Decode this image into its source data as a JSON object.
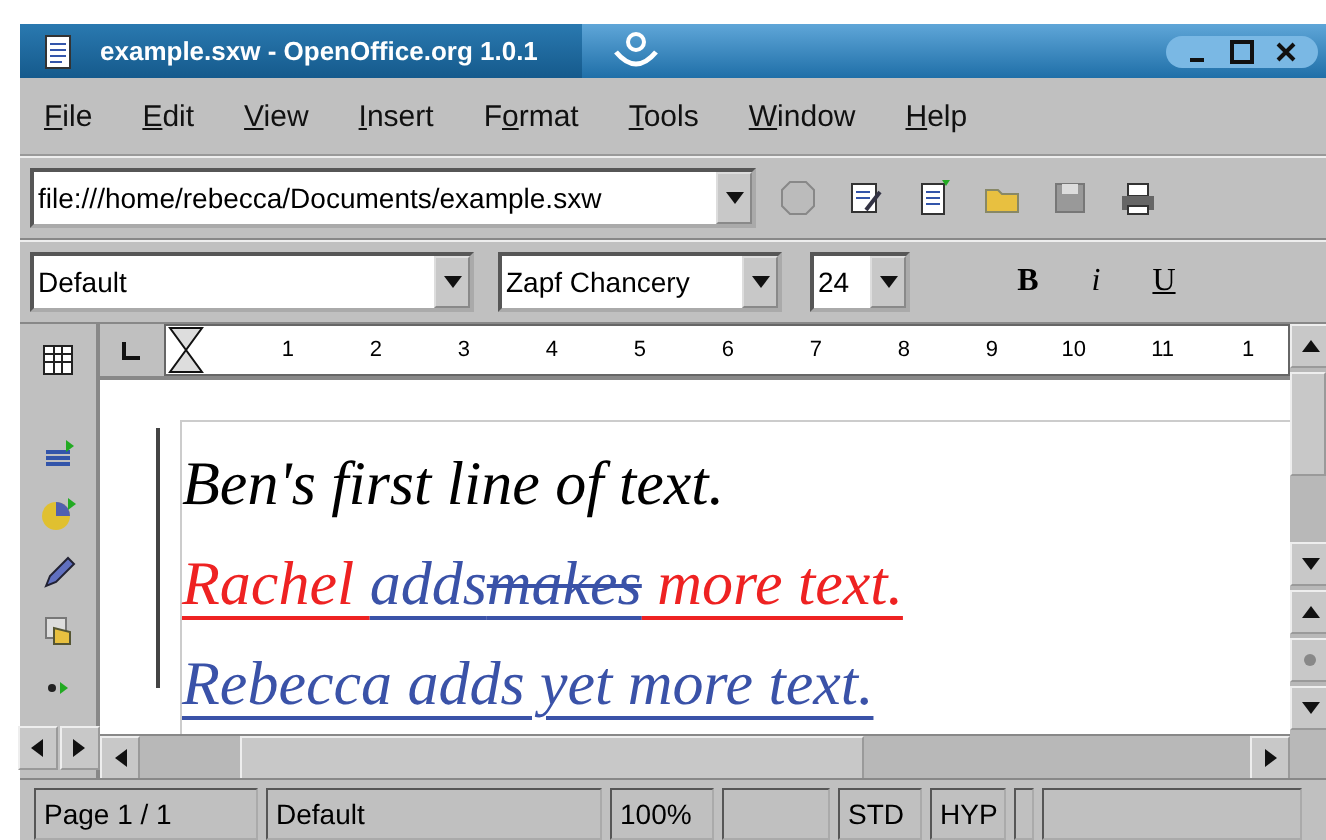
{
  "window": {
    "title": "example.sxw - OpenOffice.org 1.0.1"
  },
  "menu": [
    {
      "mnemonic": "F",
      "rest": "ile"
    },
    {
      "mnemonic": "E",
      "rest": "dit"
    },
    {
      "mnemonic": "V",
      "rest": "iew"
    },
    {
      "mnemonic": "I",
      "rest": "nsert"
    },
    {
      "lead": "F",
      "mnemonic": "o",
      "rest": "rmat"
    },
    {
      "mnemonic": "T",
      "rest": "ools"
    },
    {
      "mnemonic": "W",
      "rest": "indow"
    },
    {
      "mnemonic": "H",
      "rest": "elp"
    }
  ],
  "toolbar": {
    "url": "file:///home/rebecca/Documents/example.sxw"
  },
  "format_bar": {
    "style": "Default",
    "font": "Zapf Chancery",
    "size": "24",
    "bold": "B",
    "italic": "i",
    "underline": "U"
  },
  "ruler": {
    "labels": [
      "1",
      "2",
      "3",
      "4",
      "5",
      "6",
      "7",
      "8",
      "9",
      "10",
      "11",
      "1"
    ]
  },
  "document": {
    "lines": [
      {
        "segments": [
          {
            "text": "Ben's first line of text.",
            "kind": "plain",
            "color": "#000000"
          }
        ]
      },
      {
        "segments": [
          {
            "text": "Rachel ",
            "kind": "inserted",
            "color": "#ee2222"
          },
          {
            "text": "adds",
            "kind": "inserted",
            "color": "#3a52a8"
          },
          {
            "text": "makes",
            "kind": "deleted",
            "color": "#3a52a8"
          },
          {
            "text": " more text.",
            "kind": "inserted",
            "color": "#ee2222"
          }
        ]
      },
      {
        "segments": [
          {
            "text": "Rebecca adds yet more text.",
            "kind": "inserted",
            "color": "#3a52a8"
          }
        ]
      }
    ]
  },
  "status_bar": {
    "page": "Page 1 / 1",
    "style": "Default",
    "zoom": "100%",
    "mode": "STD",
    "hyphenation": "HYP"
  }
}
